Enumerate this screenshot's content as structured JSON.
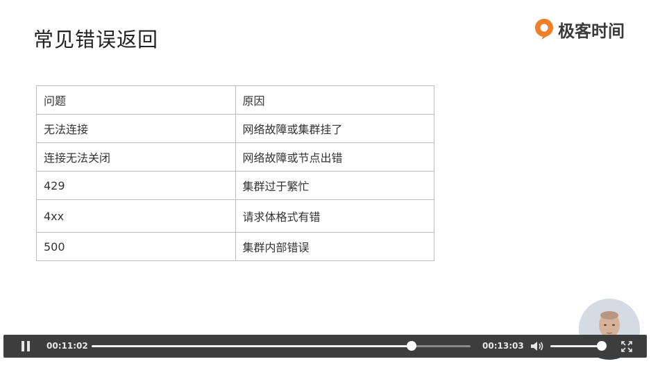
{
  "slide": {
    "title": "常见错误返回",
    "brand": "极客时间"
  },
  "table": {
    "header": [
      "问题",
      "原因"
    ],
    "rows": [
      [
        "无法连接",
        "网络故障或集群挂了"
      ],
      [
        "连接无法关闭",
        "网络故障或节点出错"
      ],
      [
        "429",
        "集群过于繁忙"
      ],
      [
        "4xx",
        "请求体格式有错"
      ],
      [
        "500",
        "集群内部错误"
      ]
    ]
  },
  "player": {
    "current_time": "00:11:02",
    "total_time": "00:13:03",
    "progress_fraction": 0.845,
    "volume_fraction": 0.92,
    "icons": [
      "pause-icon",
      "volume-icon",
      "fullscreen-icon"
    ],
    "colors": {
      "bar": "#3d3d3d",
      "track": "#8a8a8a",
      "fill": "#f0f0f0"
    }
  },
  "colors": {
    "brand_orange": "#f07f2a",
    "text": "#333333",
    "border": "#bdbdbd"
  }
}
